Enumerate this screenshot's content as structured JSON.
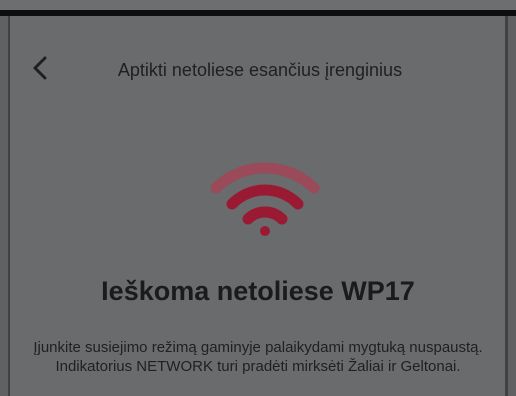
{
  "header": {
    "title": "Aptikti netoliese esančius įrenginius",
    "back_icon": "chevron-left-icon"
  },
  "main": {
    "status_icon": "wifi-icon",
    "heading": "Ieškoma netoliese WP17",
    "description": "Įjunkite susiejimo režimą gaminyje palaikydami mygtuką nuspaustą. Indikatorius NETWORK turi pradėti mirksėti Žaliai ir Geltonai."
  },
  "colors": {
    "accent": "#9b1a33",
    "accent_faded": "#9a4a58",
    "overlay": "#6a6b6c"
  }
}
